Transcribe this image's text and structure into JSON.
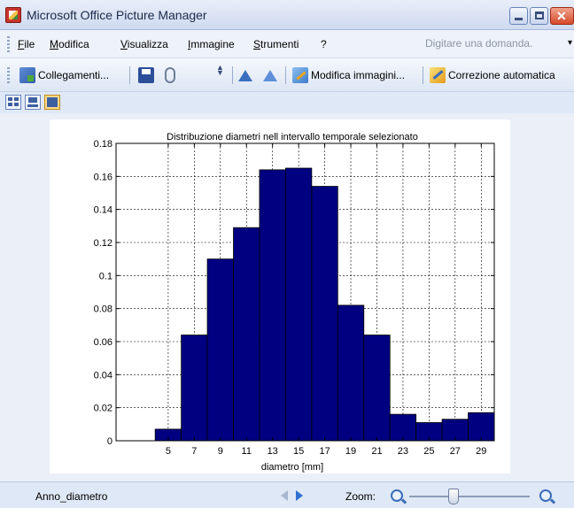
{
  "window": {
    "title": "Microsoft Office Picture Manager"
  },
  "menu": {
    "items": [
      "File",
      "Modifica",
      "Visualizza",
      "Immagine",
      "Strumenti",
      "?"
    ],
    "ask_placeholder": "Digitare una domanda."
  },
  "toolbar": {
    "links_label": "Collegamenti...",
    "edit_label": "Modifica immagini...",
    "auto_label": "Correzione automatica"
  },
  "status": {
    "file_name": "Anno_diametro",
    "zoom_label": "Zoom:",
    "zoom_level": 0.37
  },
  "colors": {
    "bar_fill": "#000080",
    "bar_stroke": "#000000"
  },
  "icons": [
    "app-icon",
    "links-icon",
    "save-icon",
    "attach-icon",
    "rotate-left-icon",
    "rotate-right-icon",
    "edit-image-icon",
    "auto-correct-icon",
    "thumbnails-icon",
    "filmstrip-icon",
    "single-picture-icon",
    "zoom-out-icon",
    "zoom-in-icon"
  ],
  "chart_data": {
    "type": "bar",
    "title": "Distribuzione diametri nell intervallo temporale selezionato",
    "xlabel": "diametro [mm]",
    "ylabel": "",
    "x": [
      5,
      7,
      9,
      11,
      13,
      15,
      17,
      19,
      21,
      23,
      25,
      27,
      29
    ],
    "values": [
      0.007,
      0.064,
      0.11,
      0.129,
      0.164,
      0.165,
      0.154,
      0.082,
      0.064,
      0.016,
      0.011,
      0.013,
      0.017
    ],
    "xlim": [
      1,
      30
    ],
    "xticks": [
      5,
      7,
      9,
      11,
      13,
      15,
      17,
      19,
      21,
      23,
      25,
      27,
      29
    ],
    "ylim": [
      0,
      0.18
    ],
    "yticks": [
      0,
      0.02,
      0.04,
      0.06,
      0.08,
      0.1,
      0.12,
      0.14,
      0.16,
      0.18
    ],
    "ytick_labels": [
      "0",
      "0.02",
      "0.04",
      "0.06",
      "0.08",
      "0.1",
      "0.12",
      "0.14",
      "0.16",
      "0.18"
    ],
    "grid": true
  }
}
